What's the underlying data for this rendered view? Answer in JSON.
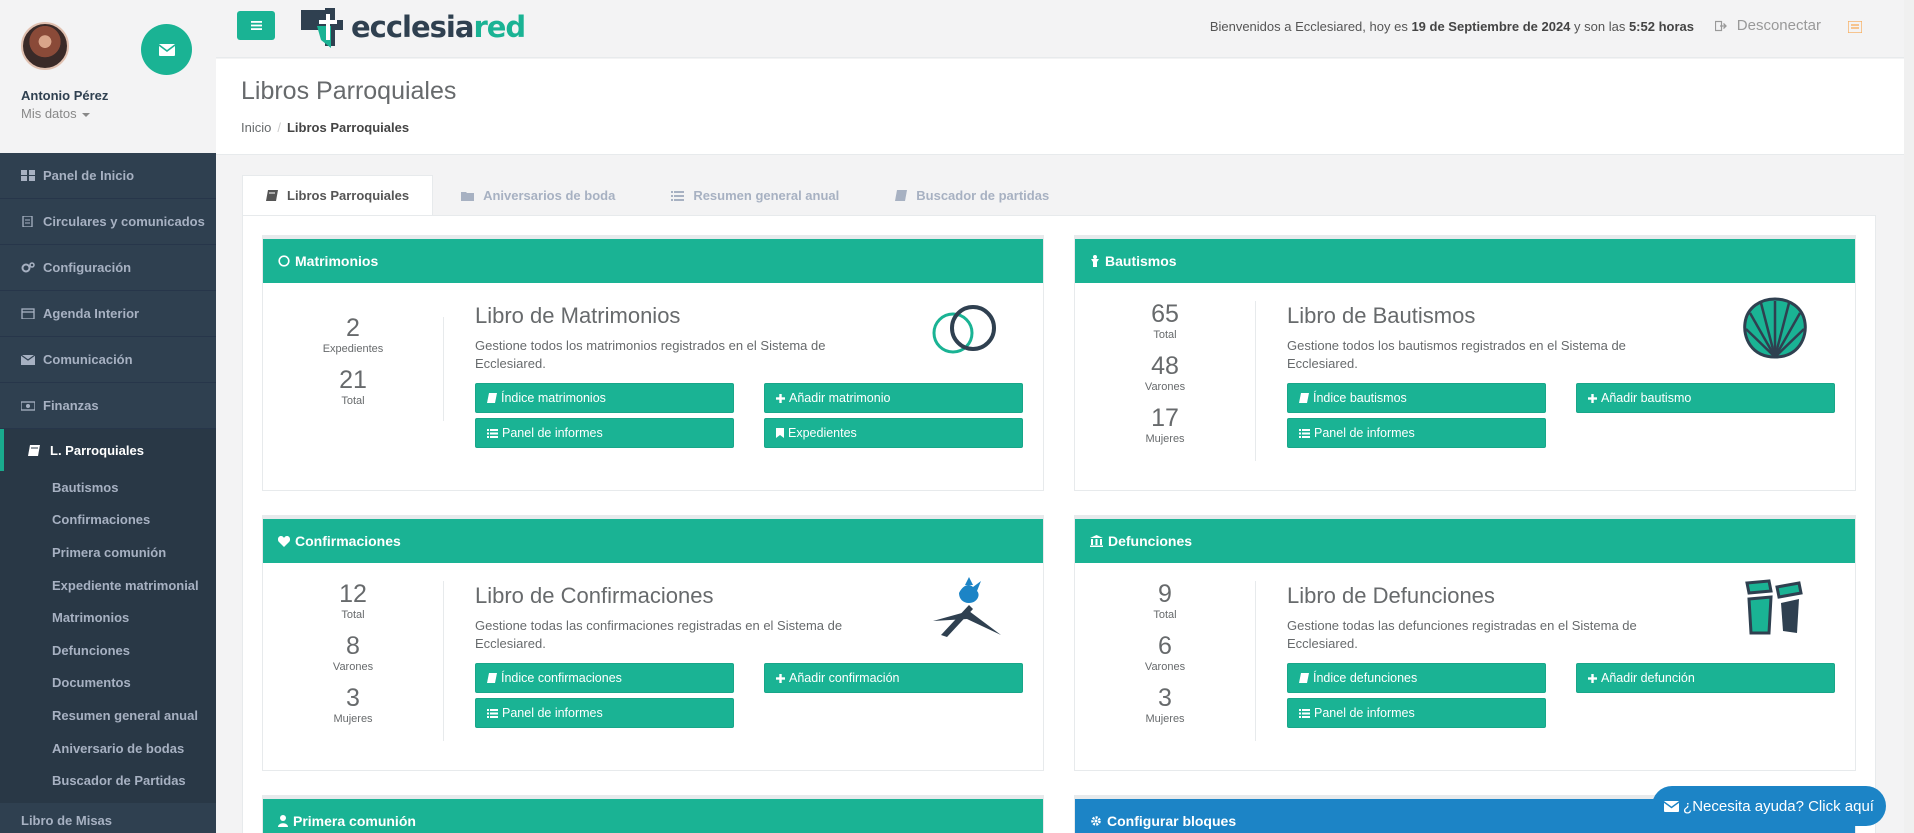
{
  "profile": {
    "name": "Antonio Pérez",
    "sub": "Mis datos"
  },
  "sidebar": {
    "items": [
      {
        "label": "Panel de Inicio",
        "icon": "grid-icon"
      },
      {
        "label": "Circulares y comunicados",
        "icon": "file-icon"
      },
      {
        "label": "Configuración",
        "icon": "gears-icon"
      },
      {
        "label": "Agenda Interior",
        "icon": "calendar-icon"
      },
      {
        "label": "Comunicación",
        "icon": "envelope-icon"
      },
      {
        "label": "Finanzas",
        "icon": "money-icon"
      }
    ],
    "active": {
      "label": "L. Parroquiales",
      "icon": "book-icon"
    },
    "sub": [
      "Bautismos",
      "Confirmaciones",
      "Primera comunión",
      "Expediente matrimonial",
      "Matrimonios",
      "Defunciones",
      "Documentos",
      "Resumen general anual",
      "Aniversario de bodas",
      "Buscador de Partidas"
    ],
    "tail": "Libro de Misas"
  },
  "topbar": {
    "logo_a": "ecclesia",
    "logo_b": "red",
    "welcome_pre": "Bienvenidos a Ecclesiared, hoy es ",
    "welcome_date": "19 de Septiembre de 2024",
    "welcome_mid": " y son las ",
    "welcome_time": "5:52 horas",
    "logout": "Desconectar"
  },
  "page": {
    "title": "Libros Parroquiales",
    "breadcrumb_home": "Inicio",
    "breadcrumb_current": "Libros Parroquiales"
  },
  "tabs": [
    "Libros Parroquiales",
    "Aniversarios de boda",
    "Resumen general anual",
    "Buscador de partidas"
  ],
  "panels": {
    "matrimonios": {
      "header": "Matrimonios",
      "stats": [
        {
          "value": "2",
          "label": "Expedientes"
        },
        {
          "value": "21",
          "label": "Total"
        }
      ],
      "title": "Libro de Matrimonios",
      "desc": "Gestione todos los matrimonios registrados en el Sistema de Ecclesiared.",
      "btn_index": "Índice matrimonios",
      "btn_add": "Añadir matrimonio",
      "btn_reports": "Panel de informes",
      "btn_files": "Expedientes"
    },
    "bautismos": {
      "header": "Bautismos",
      "stats": [
        {
          "value": "65",
          "label": "Total"
        },
        {
          "value": "48",
          "label": "Varones"
        },
        {
          "value": "17",
          "label": "Mujeres"
        }
      ],
      "title": "Libro de Bautismos",
      "desc": "Gestione todos los bautismos registrados en el Sistema de Ecclesiared.",
      "btn_index": "Índice bautismos",
      "btn_add": "Añadir bautismo",
      "btn_reports": "Panel de informes"
    },
    "confirmaciones": {
      "header": "Confirmaciones",
      "stats": [
        {
          "value": "12",
          "label": "Total"
        },
        {
          "value": "8",
          "label": "Varones"
        },
        {
          "value": "3",
          "label": "Mujeres"
        }
      ],
      "title": "Libro de Confirmaciones",
      "desc": "Gestione todas las confirmaciones registradas en el Sistema de Ecclesiared.",
      "btn_index": "Índice confirmaciones",
      "btn_add": "Añadir confirmación",
      "btn_reports": "Panel de informes"
    },
    "defunciones": {
      "header": "Defunciones",
      "stats": [
        {
          "value": "9",
          "label": "Total"
        },
        {
          "value": "6",
          "label": "Varones"
        },
        {
          "value": "3",
          "label": "Mujeres"
        }
      ],
      "title": "Libro de Defunciones",
      "desc": "Gestione todas las defunciones registradas en el Sistema de Ecclesiared.",
      "btn_index": "Índice defunciones",
      "btn_add": "Añadir defunción",
      "btn_reports": "Panel de informes"
    },
    "primera": {
      "header": "Primera comunión"
    },
    "config": {
      "header": "Configurar bloques"
    }
  },
  "help": "¿Necesita ayuda? Click aquí",
  "colors": {
    "primary": "#1ab394",
    "sidebar": "#2f4050",
    "blue": "#1c84c6"
  }
}
